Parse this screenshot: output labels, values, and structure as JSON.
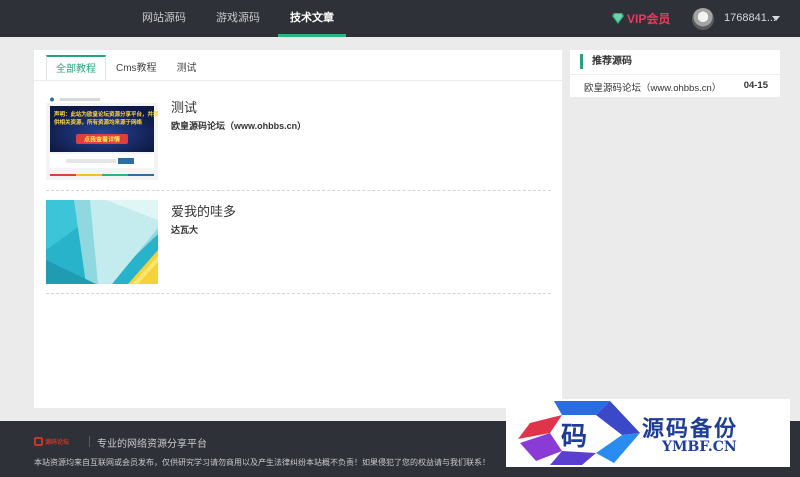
{
  "header": {
    "nav": [
      {
        "label": "网站源码",
        "active": false
      },
      {
        "label": "游戏源码",
        "active": false
      },
      {
        "label": "技术文章",
        "active": true
      }
    ],
    "vip_label": "VIP会员",
    "vip_icon": "diamond-icon",
    "user_name": "1768841...",
    "accent_color": "#27b580",
    "vip_color": "#e83c5f"
  },
  "tabs": [
    {
      "label": "全部教程",
      "active": true
    },
    {
      "label": "Cms教程",
      "active": false
    },
    {
      "label": "测试",
      "active": false
    }
  ],
  "articles": [
    {
      "title": "测试",
      "subtitle": "欧皇源码论坛（www.ohbbs.cn）",
      "thumb_text_lines": [
        "声明：此站为欧皇论坛资源分享平台，并提",
        "供相关资源，所有资源均来源于网络"
      ],
      "thumb_button": "点我查看详情"
    },
    {
      "title": "爱我的哇多",
      "subtitle": "达瓦大"
    }
  ],
  "sidebar": {
    "title": "推荐源码",
    "items": [
      {
        "label": "欧皇源码论坛（www.ohbbs.cn）",
        "date": "04-15"
      }
    ]
  },
  "footer": {
    "logo_text": "源码论坛",
    "slogan": "专业的网络资源分享平台",
    "notice": "本站资源均来自互联网或会员发布，仅供研究学习请勿商用以及产生法律纠纷本站概不负责！如果侵犯了您的权益请与我们联系！"
  },
  "watermark": {
    "glyph": "码",
    "text": "源码备份",
    "url": "YMBF.CN"
  }
}
